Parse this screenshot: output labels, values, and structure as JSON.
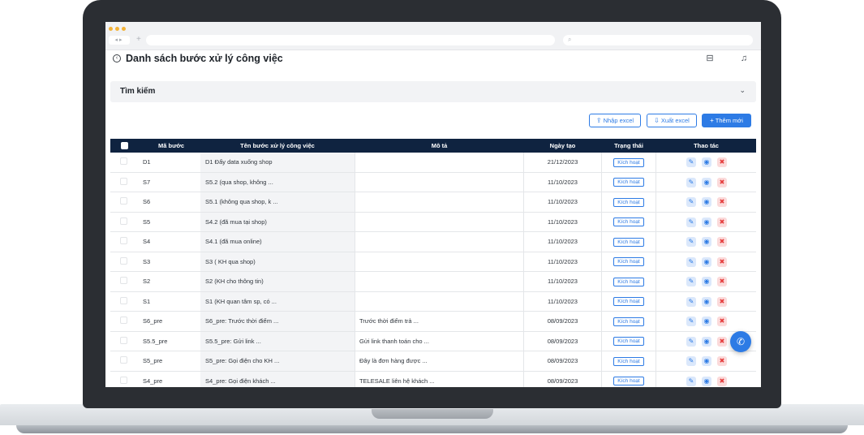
{
  "header": {
    "title": "Danh sách bước xử lý công việc"
  },
  "search": {
    "title": "Tìm kiếm"
  },
  "toolbar": {
    "import_label": "Nhập excel",
    "export_label": "Xuất excel",
    "add_label": "Thêm mới"
  },
  "table": {
    "columns": [
      "Mã bước",
      "Tên bước xử lý công việc",
      "Mô tả",
      "Ngày tạo",
      "Trạng thái",
      "Thao tác"
    ],
    "rows": [
      {
        "code": "D1",
        "name": "D1 Đẩy data xuống shop",
        "desc": "",
        "date": "21/12/2023",
        "status": "Kích hoạt"
      },
      {
        "code": "S7",
        "name": "S5.2 (qua shop, không ...",
        "desc": "",
        "date": "11/10/2023",
        "status": "Kích hoạt"
      },
      {
        "code": "S6",
        "name": "S5.1 (không qua shop, k ...",
        "desc": "",
        "date": "11/10/2023",
        "status": "Kích hoạt"
      },
      {
        "code": "S5",
        "name": "S4.2 (đã mua tại shop)",
        "desc": "",
        "date": "11/10/2023",
        "status": "Kích hoạt"
      },
      {
        "code": "S4",
        "name": "S4.1 (đã mua online)",
        "desc": "",
        "date": "11/10/2023",
        "status": "Kích hoạt"
      },
      {
        "code": "S3",
        "name": "S3 ( KH qua shop)",
        "desc": "",
        "date": "11/10/2023",
        "status": "Kích hoạt"
      },
      {
        "code": "S2",
        "name": "S2 (KH cho thông tin)",
        "desc": "",
        "date": "11/10/2023",
        "status": "Kích hoạt"
      },
      {
        "code": "S1",
        "name": "S1 (KH quan tâm sp, có ...",
        "desc": "",
        "date": "11/10/2023",
        "status": "Kích hoạt"
      },
      {
        "code": "S6_pre",
        "name": "S6_pre: Trước thời điểm ...",
        "desc": "Trước thời điểm trả ...",
        "date": "08/09/2023",
        "status": "Kích hoạt"
      },
      {
        "code": "S5.5_pre",
        "name": "S5.5_pre: Gửi link ...",
        "desc": "Gửi link thanh toán cho ...",
        "date": "08/09/2023",
        "status": "Kích hoạt"
      },
      {
        "code": "S5_pre",
        "name": "S5_pre: Gọi điện cho KH ...",
        "desc": "Đây là đơn hàng được ...",
        "date": "08/09/2023",
        "status": "Kích hoạt"
      },
      {
        "code": "S4_pre",
        "name": "S4_pre: Gọi điện khách ...",
        "desc": "TELESALE liên hệ khách ...",
        "date": "08/09/2023",
        "status": "Kích hoạt"
      }
    ]
  },
  "colors": {
    "accent": "#2d7be5",
    "table_header": "#0f2340",
    "danger": "#e53a3a"
  }
}
